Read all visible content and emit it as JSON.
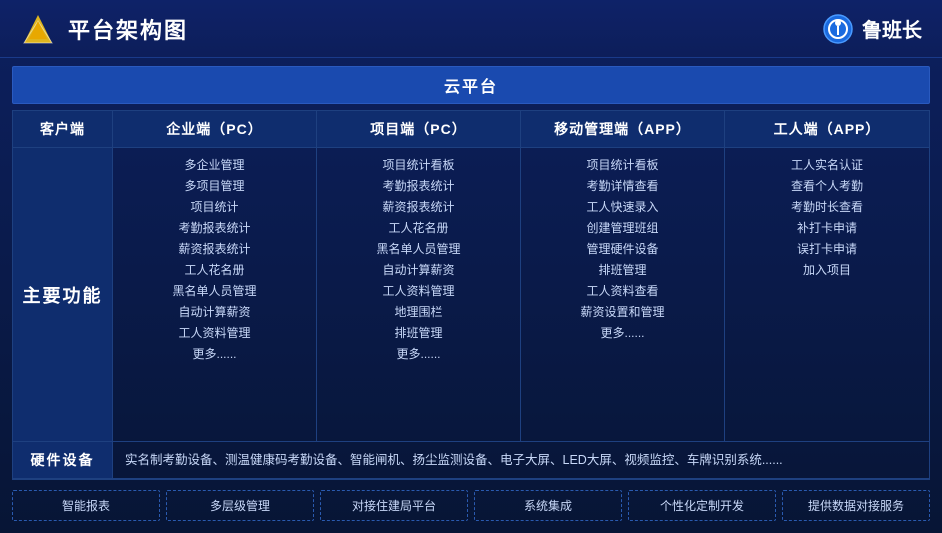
{
  "header": {
    "title": "平台架构图",
    "brand": "鲁班长"
  },
  "cloud_platform": {
    "label": "云平台"
  },
  "columns": {
    "client": "客户端",
    "enterprise": "企业端（PC）",
    "project": "项目端（PC）",
    "mobile": "移动管理端（APP）",
    "worker": "工人端（APP）"
  },
  "row_label": "主要功能",
  "enterprise_items": [
    "多企业管理",
    "多项目管理",
    "项目统计",
    "考勤报表统计",
    "薪资报表统计",
    "工人花名册",
    "黑名单人员管理",
    "自动计算薪资",
    "工人资料管理",
    "更多......"
  ],
  "project_items": [
    "项目统计看板",
    "考勤报表统计",
    "薪资报表统计",
    "工人花名册",
    "黑名单人员管理",
    "自动计算薪资",
    "工人资料管理",
    "地理围栏",
    "排班管理",
    "更多......"
  ],
  "mobile_items": [
    "项目统计看板",
    "考勤详情查看",
    "工人快速录入",
    "创建管理班组",
    "管理硬件设备",
    "排班管理",
    "工人资料查看",
    "薪资设置和管理",
    "更多......"
  ],
  "worker_items": [
    "工人实名认证",
    "查看个人考勤",
    "考勤时长查看",
    "补打卡申请",
    "误打卡申请",
    "加入项目"
  ],
  "hardware": {
    "label": "硬件设备",
    "content": "实名制考勤设备、测温健康码考勤设备、智能闸机、扬尘监测设备、电子大屏、LED大屏、视频监控、车牌识别系统......"
  },
  "features": [
    "智能报表",
    "多层级管理",
    "对接住建局平台",
    "系统集成",
    "个性化定制开发",
    "提供数据对接服务"
  ]
}
